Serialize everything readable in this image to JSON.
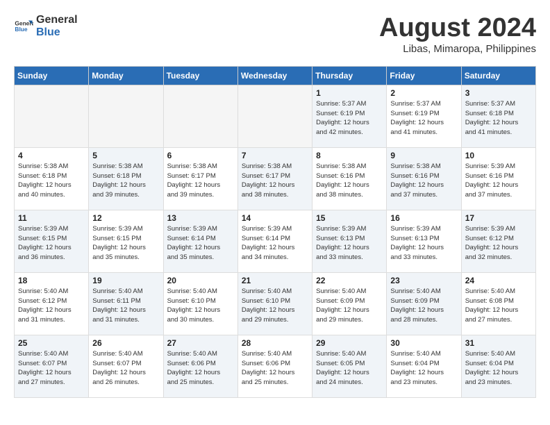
{
  "logo": {
    "general": "General",
    "blue": "Blue"
  },
  "title": "August 2024",
  "location": "Libas, Mimaropa, Philippines",
  "days_of_week": [
    "Sunday",
    "Monday",
    "Tuesday",
    "Wednesday",
    "Thursday",
    "Friday",
    "Saturday"
  ],
  "weeks": [
    [
      {
        "day": "",
        "info": "",
        "empty": true
      },
      {
        "day": "",
        "info": "",
        "empty": true
      },
      {
        "day": "",
        "info": "",
        "empty": true
      },
      {
        "day": "",
        "info": "",
        "empty": true
      },
      {
        "day": "1",
        "info": "Sunrise: 5:37 AM\nSunset: 6:19 PM\nDaylight: 12 hours\nand 42 minutes."
      },
      {
        "day": "2",
        "info": "Sunrise: 5:37 AM\nSunset: 6:19 PM\nDaylight: 12 hours\nand 41 minutes."
      },
      {
        "day": "3",
        "info": "Sunrise: 5:37 AM\nSunset: 6:18 PM\nDaylight: 12 hours\nand 41 minutes."
      }
    ],
    [
      {
        "day": "4",
        "info": "Sunrise: 5:38 AM\nSunset: 6:18 PM\nDaylight: 12 hours\nand 40 minutes."
      },
      {
        "day": "5",
        "info": "Sunrise: 5:38 AM\nSunset: 6:18 PM\nDaylight: 12 hours\nand 39 minutes."
      },
      {
        "day": "6",
        "info": "Sunrise: 5:38 AM\nSunset: 6:17 PM\nDaylight: 12 hours\nand 39 minutes."
      },
      {
        "day": "7",
        "info": "Sunrise: 5:38 AM\nSunset: 6:17 PM\nDaylight: 12 hours\nand 38 minutes."
      },
      {
        "day": "8",
        "info": "Sunrise: 5:38 AM\nSunset: 6:16 PM\nDaylight: 12 hours\nand 38 minutes."
      },
      {
        "day": "9",
        "info": "Sunrise: 5:38 AM\nSunset: 6:16 PM\nDaylight: 12 hours\nand 37 minutes."
      },
      {
        "day": "10",
        "info": "Sunrise: 5:39 AM\nSunset: 6:16 PM\nDaylight: 12 hours\nand 37 minutes."
      }
    ],
    [
      {
        "day": "11",
        "info": "Sunrise: 5:39 AM\nSunset: 6:15 PM\nDaylight: 12 hours\nand 36 minutes."
      },
      {
        "day": "12",
        "info": "Sunrise: 5:39 AM\nSunset: 6:15 PM\nDaylight: 12 hours\nand 35 minutes."
      },
      {
        "day": "13",
        "info": "Sunrise: 5:39 AM\nSunset: 6:14 PM\nDaylight: 12 hours\nand 35 minutes."
      },
      {
        "day": "14",
        "info": "Sunrise: 5:39 AM\nSunset: 6:14 PM\nDaylight: 12 hours\nand 34 minutes."
      },
      {
        "day": "15",
        "info": "Sunrise: 5:39 AM\nSunset: 6:13 PM\nDaylight: 12 hours\nand 33 minutes."
      },
      {
        "day": "16",
        "info": "Sunrise: 5:39 AM\nSunset: 6:13 PM\nDaylight: 12 hours\nand 33 minutes."
      },
      {
        "day": "17",
        "info": "Sunrise: 5:39 AM\nSunset: 6:12 PM\nDaylight: 12 hours\nand 32 minutes."
      }
    ],
    [
      {
        "day": "18",
        "info": "Sunrise: 5:40 AM\nSunset: 6:12 PM\nDaylight: 12 hours\nand 31 minutes."
      },
      {
        "day": "19",
        "info": "Sunrise: 5:40 AM\nSunset: 6:11 PM\nDaylight: 12 hours\nand 31 minutes."
      },
      {
        "day": "20",
        "info": "Sunrise: 5:40 AM\nSunset: 6:10 PM\nDaylight: 12 hours\nand 30 minutes."
      },
      {
        "day": "21",
        "info": "Sunrise: 5:40 AM\nSunset: 6:10 PM\nDaylight: 12 hours\nand 29 minutes."
      },
      {
        "day": "22",
        "info": "Sunrise: 5:40 AM\nSunset: 6:09 PM\nDaylight: 12 hours\nand 29 minutes."
      },
      {
        "day": "23",
        "info": "Sunrise: 5:40 AM\nSunset: 6:09 PM\nDaylight: 12 hours\nand 28 minutes."
      },
      {
        "day": "24",
        "info": "Sunrise: 5:40 AM\nSunset: 6:08 PM\nDaylight: 12 hours\nand 27 minutes."
      }
    ],
    [
      {
        "day": "25",
        "info": "Sunrise: 5:40 AM\nSunset: 6:07 PM\nDaylight: 12 hours\nand 27 minutes."
      },
      {
        "day": "26",
        "info": "Sunrise: 5:40 AM\nSunset: 6:07 PM\nDaylight: 12 hours\nand 26 minutes."
      },
      {
        "day": "27",
        "info": "Sunrise: 5:40 AM\nSunset: 6:06 PM\nDaylight: 12 hours\nand 25 minutes."
      },
      {
        "day": "28",
        "info": "Sunrise: 5:40 AM\nSunset: 6:06 PM\nDaylight: 12 hours\nand 25 minutes."
      },
      {
        "day": "29",
        "info": "Sunrise: 5:40 AM\nSunset: 6:05 PM\nDaylight: 12 hours\nand 24 minutes."
      },
      {
        "day": "30",
        "info": "Sunrise: 5:40 AM\nSunset: 6:04 PM\nDaylight: 12 hours\nand 23 minutes."
      },
      {
        "day": "31",
        "info": "Sunrise: 5:40 AM\nSunset: 6:04 PM\nDaylight: 12 hours\nand 23 minutes."
      }
    ]
  ]
}
